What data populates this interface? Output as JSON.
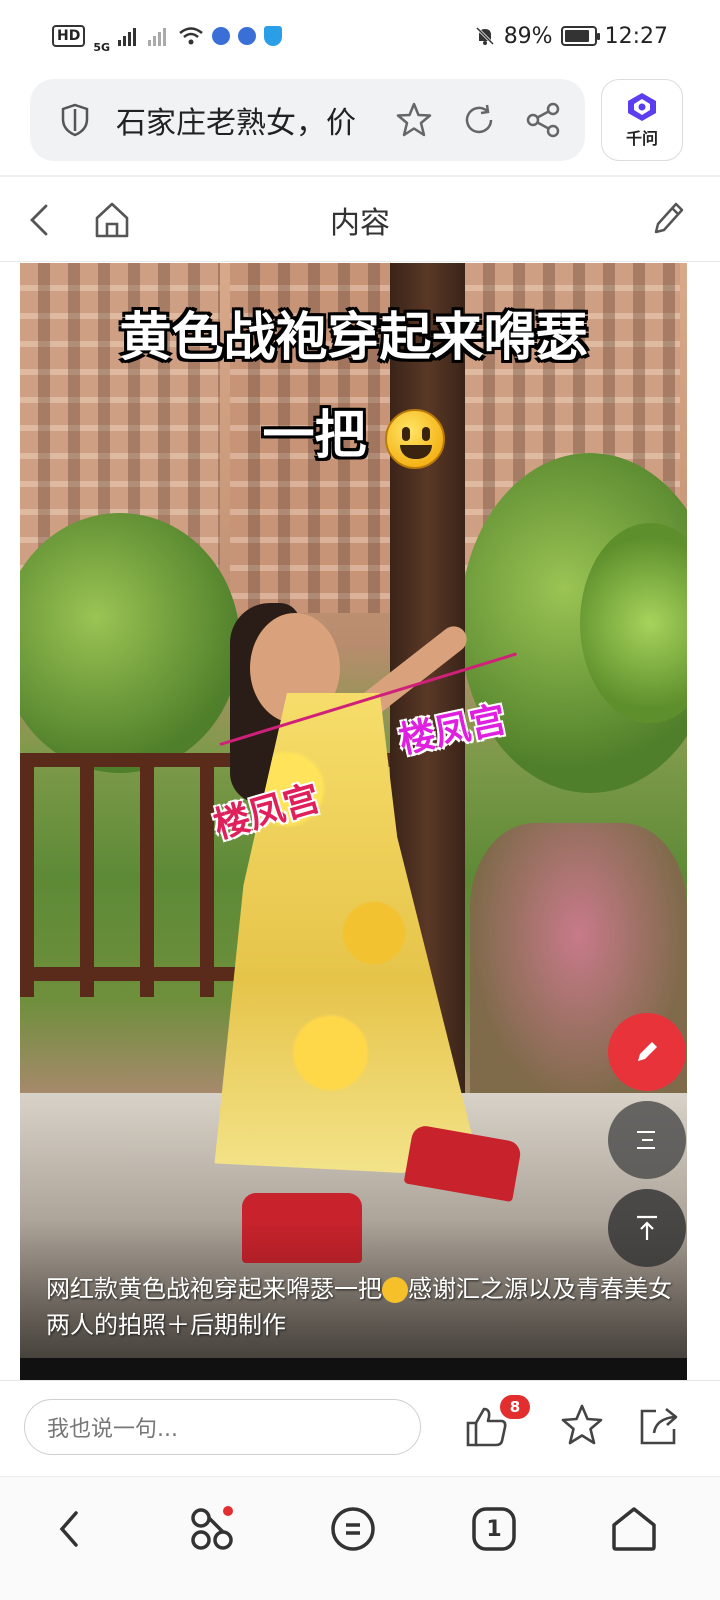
{
  "status_bar": {
    "hd": "HD",
    "network": "5G",
    "battery_percent": "89%",
    "battery_level": 0.89,
    "time": "12:27"
  },
  "address_bar": {
    "query": "石家庄老熟女，价",
    "icons": [
      "shield-icon",
      "star-icon",
      "refresh-icon",
      "share-icon"
    ],
    "assistant_label": "千问"
  },
  "nav": {
    "title": "内容",
    "icons": [
      "back-icon",
      "home-icon",
      "edit-icon"
    ]
  },
  "post": {
    "overlay_line1": "黄色战袍穿起来嘚瑟",
    "overlay_line2": "一把",
    "watermark_1": "楼凤宫",
    "watermark_2": "楼凤宫",
    "caption_part1": "网红款黄色战袍穿起来嘚瑟一把",
    "caption_part2": "感谢汇之源以及青春美女两人的拍照＋后期制作"
  },
  "floating_buttons": {
    "icons": [
      "pencil-icon",
      "outline-icon",
      "back-to-top-icon"
    ],
    "accent_color": "#e8333b"
  },
  "comment_bar": {
    "placeholder": "我也说一句...",
    "like_count": "8",
    "icons": [
      "thumbs-up-icon",
      "star-icon",
      "share-icon"
    ]
  },
  "browser_bar": {
    "tab_count": "1",
    "icons": [
      "back-icon",
      "apps-icon",
      "menu-icon",
      "tabs-icon",
      "home-icon"
    ]
  }
}
